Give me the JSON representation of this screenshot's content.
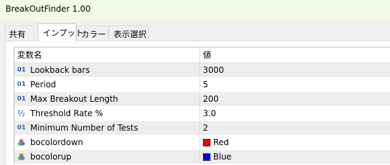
{
  "window": {
    "title": "BreakOutFinder 1.00"
  },
  "tabs": [
    {
      "label": "共有",
      "active": false
    },
    {
      "label": "インプット",
      "active": true
    },
    {
      "label": "カラー",
      "active": false
    },
    {
      "label": "表示選択",
      "active": false
    }
  ],
  "table": {
    "headers": {
      "name": "変数名",
      "value": "値"
    },
    "rows": [
      {
        "icon": "integer-icon",
        "icon_text": "01",
        "name": "Lookback bars",
        "value": "3000"
      },
      {
        "icon": "integer-icon",
        "icon_text": "01",
        "name": "Period",
        "value": "5"
      },
      {
        "icon": "integer-icon",
        "icon_text": "01",
        "name": "Max Breakout Length",
        "value": "200"
      },
      {
        "icon": "fraction-icon",
        "icon_text": "½",
        "name": "Threshold Rate %",
        "value": "3.0"
      },
      {
        "icon": "integer-icon",
        "icon_text": "01",
        "name": "Minimum Number of Tests",
        "value": "2"
      },
      {
        "icon": "color-icon",
        "name": "bocolordown",
        "value": "Red",
        "swatch": "#ff0000"
      },
      {
        "icon": "color-icon",
        "name": "bocolorup",
        "value": "Blue",
        "swatch": "#0000ff"
      }
    ]
  }
}
